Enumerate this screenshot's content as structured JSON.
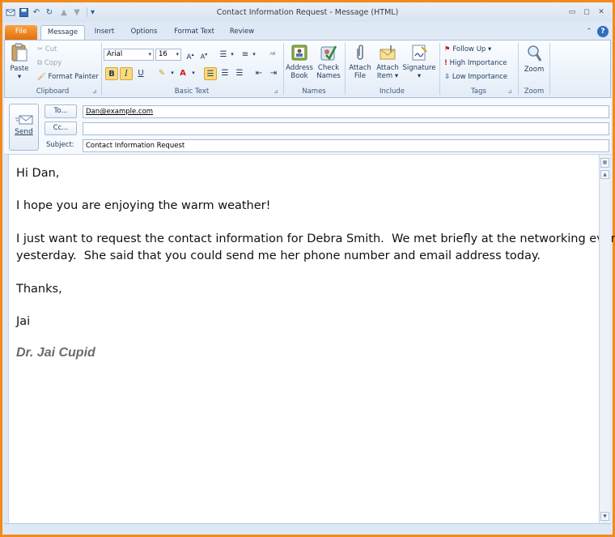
{
  "window": {
    "title": "Contact Information Request  -  Message (HTML)",
    "min_icon": "minimize-icon",
    "max_icon": "maximize-icon",
    "close_icon": "close-icon",
    "minimize_glyph": "▭",
    "restore_glyph": "◻",
    "close_glyph": "✕",
    "help_glyph": "?",
    "collapse_glyph": "⌃"
  },
  "tabs": [
    {
      "label": "File"
    },
    {
      "label": "Message"
    },
    {
      "label": "Insert"
    },
    {
      "label": "Options"
    },
    {
      "label": "Format Text"
    },
    {
      "label": "Review"
    }
  ],
  "ribbon": {
    "clipboard": {
      "paste": "Paste",
      "cut": "Cut",
      "copy": "Copy",
      "format_painter": "Format Painter",
      "label": "Clipboard"
    },
    "basic_text": {
      "font": "Arial",
      "size": "16",
      "bold": "B",
      "italic": "I",
      "underline": "U",
      "label": "Basic Text"
    },
    "names": {
      "address_book": [
        "Address",
        "Book"
      ],
      "check_names": [
        "Check",
        "Names"
      ],
      "label": "Names"
    },
    "include": {
      "attach_file": [
        "Attach",
        "File"
      ],
      "attach_item": [
        "Attach",
        "Item ▾"
      ],
      "signature": [
        "Signature",
        "▾"
      ],
      "label": "Include"
    },
    "tags": {
      "follow_up": "Follow Up ▾",
      "high_importance": "High Importance",
      "low_importance": "Low Importance",
      "label": "Tags"
    },
    "zoom": {
      "zoom": "Zoom",
      "label": "Zoom"
    }
  },
  "header": {
    "send": "Send",
    "to_button": "To...",
    "cc_button": "Cc...",
    "subject_label": "Subject:",
    "to_value": "Dan@example.com",
    "cc_value": "",
    "subject_value": "Contact Information Request"
  },
  "message": {
    "greeting": "Hi Dan,",
    "line1": "I hope you are enjoying the warm weather!",
    "line2a": "I just want to request the contact information for Debra Smith.  We met briefly at the networking event",
    "line2b": "yesterday.  She said that you could send me her phone number and email address today.",
    "closing": "Thanks,",
    "name": "Jai",
    "signature": "Dr. Jai Cupid"
  },
  "colors": {
    "frame": "#f28a1c",
    "file_tab": "#e56f0c",
    "ribbon_text": "#1e395b",
    "signature": "#6b6b6b"
  }
}
